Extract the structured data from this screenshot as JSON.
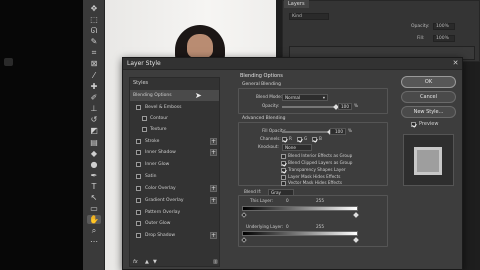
{
  "layers_panel": {
    "tab_label": "Layers",
    "filter_placeholder": "Kind",
    "opacity_label": "Opacity:",
    "opacity_value": "100%",
    "fill_label": "Fill:",
    "fill_value": "100%"
  },
  "dialog": {
    "title": "Layer Style",
    "styles_header": "Styles",
    "styles": [
      {
        "label": "Blending Options",
        "selected": true
      },
      {
        "label": "Bevel & Emboss"
      },
      {
        "label": "Contour"
      },
      {
        "label": "Texture"
      },
      {
        "label": "Stroke"
      },
      {
        "label": "Inner Shadow"
      },
      {
        "label": "Inner Glow"
      },
      {
        "label": "Satin"
      },
      {
        "label": "Color Overlay"
      },
      {
        "label": "Gradient Overlay"
      },
      {
        "label": "Pattern Overlay"
      },
      {
        "label": "Outer Glow"
      },
      {
        "label": "Drop Shadow"
      }
    ],
    "fx_label": "fx",
    "blending_options_title": "Blending Options",
    "general_blending_title": "General Blending",
    "blend_mode_label": "Blend Mode:",
    "blend_mode_value": "Normal",
    "opacity_label": "Opacity:",
    "opacity_value": "100",
    "percent": "%",
    "advanced_blending_title": "Advanced Blending",
    "fill_opacity_label": "Fill Opacity:",
    "fill_opacity_value": "100",
    "channels_label": "Channels:",
    "channel_r": "R",
    "channel_g": "G",
    "channel_b": "B",
    "knockout_label": "Knockout:",
    "knockout_value": "None",
    "checks": [
      {
        "label": "Blend Interior Effects as Group",
        "checked": false
      },
      {
        "label": "Blend Clipped Layers as Group",
        "checked": true
      },
      {
        "label": "Transparency Shapes Layer",
        "checked": true
      },
      {
        "label": "Layer Mask Hides Effects",
        "checked": false
      },
      {
        "label": "Vector Mask Hides Effects",
        "checked": false
      }
    ],
    "blend_if_label": "Blend If:",
    "blend_if_value": "Gray",
    "this_layer_label": "This Layer:",
    "this_layer_min": "0",
    "this_layer_max": "255",
    "underlying_label": "Underlying Layer:",
    "underlying_min": "0",
    "underlying_max": "255",
    "buttons": {
      "ok": "OK",
      "cancel": "Cancel",
      "new_style": "New Style..."
    },
    "preview_label": "Preview"
  }
}
